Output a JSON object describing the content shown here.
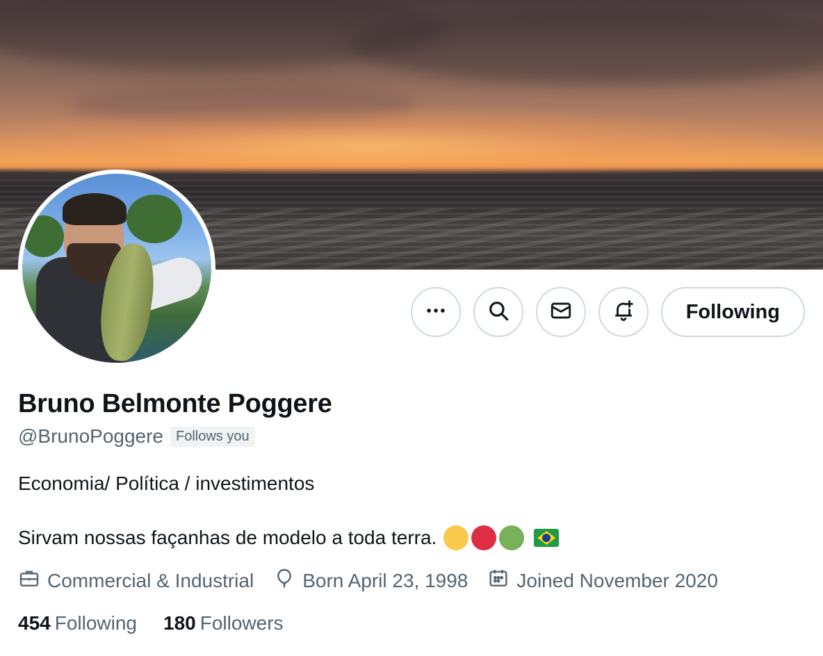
{
  "banner": {
    "description_icon": "sunset-banner-image"
  },
  "avatar": {
    "icon": "profile-photo"
  },
  "actions": {
    "more_icon": "more-horizontal-icon",
    "search_icon": "search-icon",
    "message_icon": "envelope-icon",
    "notify_icon": "bell-plus-icon",
    "follow_label": "Following"
  },
  "profile": {
    "name": "Bruno Belmonte Poggere",
    "handle": "@BrunoPoggere",
    "follows_you": "Follows you",
    "bio_line1": "Economia/ Política / investimentos",
    "bio_line2": "Sirvam nossas façanhas de modelo a toda terra.",
    "bio_emoji": [
      {
        "name": "yellow-circle",
        "color": "#f8c94d"
      },
      {
        "name": "red-circle",
        "color": "#dd2e44"
      },
      {
        "name": "green-circle",
        "color": "#78b159"
      },
      {
        "name": "brazil-flag",
        "color": "#1e9c43"
      }
    ],
    "category": "Commercial & Industrial",
    "born": "Born April 23, 1998",
    "joined": "Joined November 2020"
  },
  "stats": {
    "following_count": "454",
    "following_label": "Following",
    "followers_count": "180",
    "followers_label": "Followers"
  },
  "colors": {
    "text_primary": "#0f1419",
    "text_secondary": "#536471",
    "border": "#cfd9de"
  }
}
